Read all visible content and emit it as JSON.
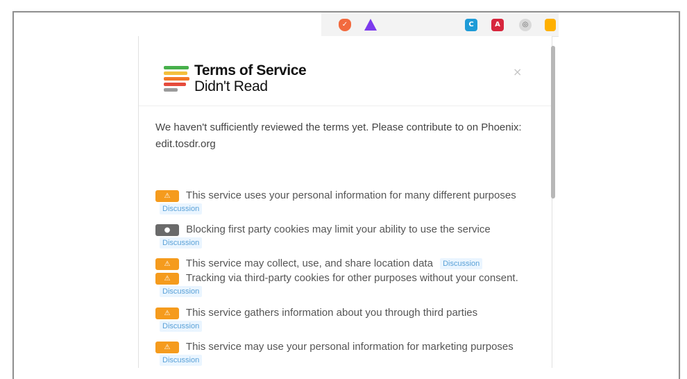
{
  "toolbar": {
    "icons": [
      {
        "name": "shield-icon",
        "symbol": "✓",
        "color": "#f26a3e"
      },
      {
        "name": "warning-triangle-icon",
        "symbol": "",
        "color": "#7c3aed"
      },
      {
        "name": "blue-extension-icon",
        "symbol": "C",
        "color": "#1e9bd7"
      },
      {
        "name": "red-extension-icon",
        "symbol": "A",
        "color": "#d7263d"
      },
      {
        "name": "gray-extension-icon",
        "symbol": "◎",
        "color": "#d9d9d9"
      },
      {
        "name": "orange-extension-icon",
        "symbol": "",
        "color": "#ffb000"
      }
    ]
  },
  "popup": {
    "brand": {
      "title": "Terms of Service",
      "subtitle": "Didn't Read",
      "close": "×"
    },
    "intro": "We haven't sufficiently reviewed the terms yet. Please contribute to on Phoenix: edit.tosdr.org",
    "discussion_label": "Discussion",
    "items": [
      {
        "badge_symbol": "⚠",
        "badge_color": "#f59b1d",
        "text": "This service uses your personal information for many different purposes"
      },
      {
        "badge_symbol": "●",
        "badge_color": "#6a6a6a",
        "text": "Blocking first party cookies may limit your ability to use the service"
      },
      {
        "badge_symbol": "⚠",
        "badge_color": "#f59b1d",
        "text": "This service may collect, use, and share location data"
      },
      {
        "badge_symbol": "⚠",
        "badge_color": "#f59b1d",
        "text": "Tracking via third-party cookies for other purposes without your consent."
      },
      {
        "badge_symbol": "⚠",
        "badge_color": "#f59b1d",
        "text": "This service gathers information about you through third parties"
      },
      {
        "badge_symbol": "⚠",
        "badge_color": "#f59b1d",
        "text": "This service may use your personal information for marketing purposes"
      }
    ]
  }
}
